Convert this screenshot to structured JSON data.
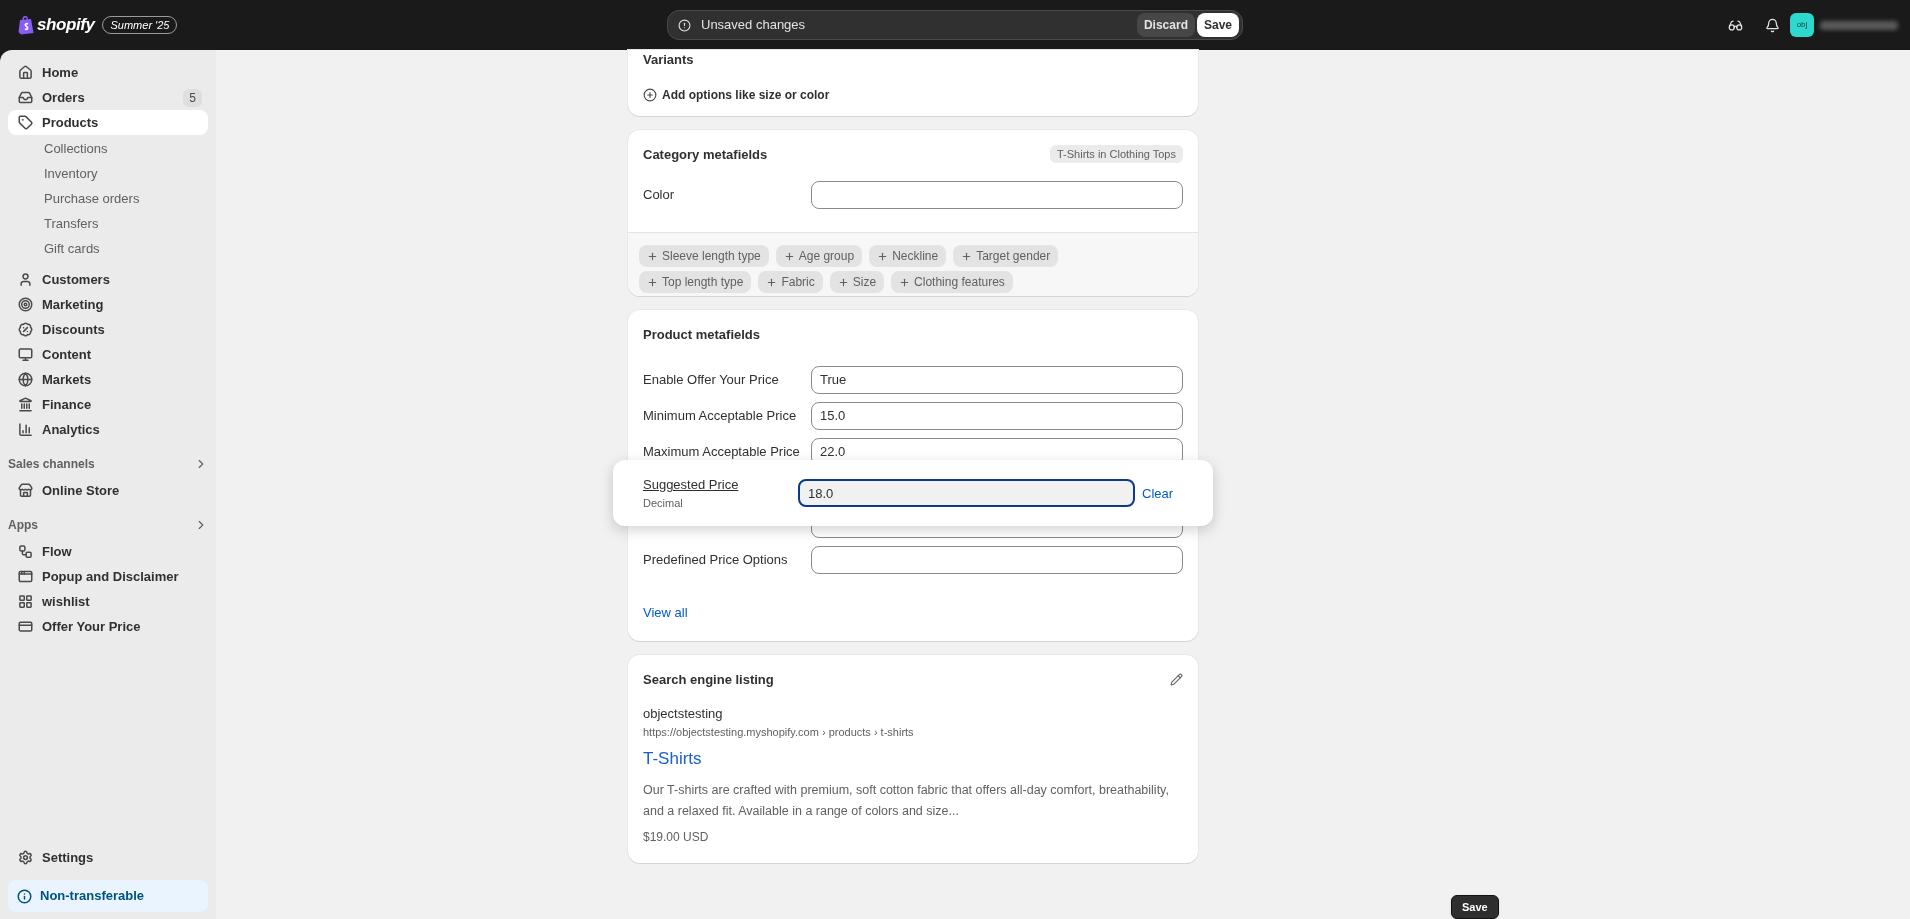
{
  "top_bar": {
    "logo": "shopify",
    "edition_badge": "Summer '25",
    "unsaved_bar": {
      "message": "Unsaved changes",
      "buttons": [
        "Discard",
        "Save"
      ]
    },
    "avatar": "obj"
  },
  "sidebar": {
    "items": [
      {
        "label": "Home",
        "selected": false
      },
      {
        "label": "Orders",
        "badge": "5",
        "selected": false
      },
      {
        "label": "Products",
        "selected": true,
        "children": [
          {
            "label": "Collections",
            "selected": false
          },
          {
            "label": "Inventory",
            "selected": false
          },
          {
            "label": "Purchase orders",
            "selected": false
          },
          {
            "label": "Transfers",
            "selected": false
          },
          {
            "label": "Gift cards",
            "selected": false
          }
        ]
      },
      {
        "label": "Customers",
        "selected": false
      },
      {
        "label": "Marketing",
        "selected": false
      },
      {
        "label": "Discounts",
        "selected": false
      },
      {
        "label": "Content",
        "selected": false
      },
      {
        "label": "Markets",
        "selected": false
      },
      {
        "label": "Finance",
        "selected": false
      },
      {
        "label": "Analytics",
        "selected": false
      }
    ],
    "sections": [
      {
        "title": "Sales channels",
        "items": [
          {
            "label": "Online Store",
            "selected": false
          }
        ]
      },
      {
        "title": "Apps",
        "items": [
          {
            "label": "Flow",
            "selected": false
          },
          {
            "label": "Popup and Disclaimer",
            "selected": false
          },
          {
            "label": "wishlist",
            "selected": false
          },
          {
            "label": "Offer Your Price",
            "selected": false
          }
        ]
      }
    ],
    "settings": "Settings",
    "banner": "Non-transferable"
  },
  "variants_card": {
    "title": "Variants",
    "action": "Add options like size or color"
  },
  "category_card": {
    "title": "Category metafields",
    "category_tag": "T-Shirts in Clothing Tops",
    "fields": [
      {
        "label": "Color"
      }
    ],
    "suggestions": [
      "Sleeve length type",
      "Age group",
      "Neckline",
      "Target gender",
      "Top length type",
      "Fabric",
      "Size",
      "Clothing features"
    ]
  },
  "product_metafields_card": {
    "title": "Product metafields",
    "rows": [
      {
        "kind": "field",
        "label": "Enable Offer Your Price",
        "value": "True"
      },
      {
        "kind": "field",
        "label": "Minimum Acceptable Price",
        "value": "15.0"
      },
      {
        "kind": "field",
        "label": "Maximum Acceptable Price",
        "value": "22.0"
      },
      {
        "kind": "covered"
      },
      {
        "kind": "field",
        "label": "Predefined Price Options"
      }
    ],
    "popover": {
      "label": "Suggested Price",
      "type": "Decimal",
      "value": "18.0",
      "action": "Clear"
    },
    "link": "View all"
  },
  "seo_card": {
    "title": "Search engine listing",
    "site": "objectstesting",
    "url": "https://objectstesting.myshopify.com › products › t-shirts",
    "page_title": "T-Shirts",
    "description": "Our T-shirts are crafted with premium, soft cotton fabric that offers all-day comfort, breathability, and a relaxed fit. Available in a range of colors and size...",
    "price": "$19.00 USD"
  },
  "footer": {
    "button": "Save"
  }
}
